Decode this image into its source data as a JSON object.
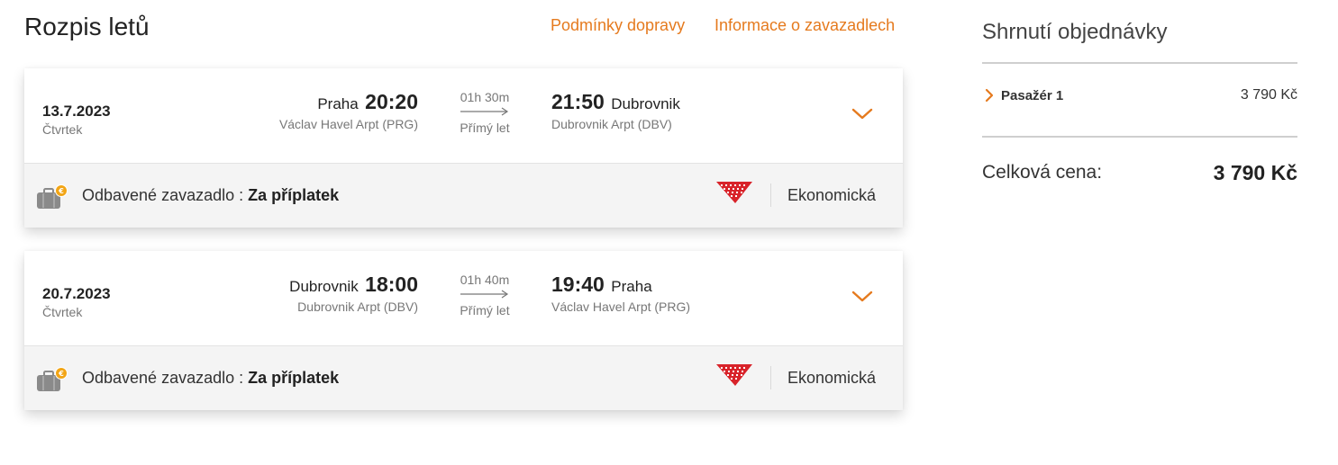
{
  "header": {
    "title": "Rozpis letů",
    "conditions_link": "Podmínky dopravy",
    "baggage_link": "Informace o zavazadlech"
  },
  "flights": [
    {
      "date": "13.7.2023",
      "weekday": "Čtvrtek",
      "departure": {
        "city": "Praha",
        "time": "20:20",
        "airport": "Václav Havel Arpt (PRG)"
      },
      "duration": "01h 30m",
      "stops": "Přímý let",
      "arrival": {
        "city": "Dubrovnik",
        "time": "21:50",
        "airport": "Dubrovnik Arpt (DBV)"
      },
      "baggage_label": "Odbavené zavazadlo :",
      "baggage_value": "Za příplatek",
      "cabin": "Ekonomická"
    },
    {
      "date": "20.7.2023",
      "weekday": "Čtvrtek",
      "departure": {
        "city": "Dubrovnik",
        "time": "18:00",
        "airport": "Dubrovnik Arpt (DBV)"
      },
      "duration": "01h 40m",
      "stops": "Přímý let",
      "arrival": {
        "city": "Praha",
        "time": "19:40",
        "airport": "Václav Havel Arpt (PRG)"
      },
      "baggage_label": "Odbavené zavazadlo :",
      "baggage_value": "Za příplatek",
      "cabin": "Ekonomická"
    }
  ],
  "summary": {
    "title": "Shrnutí objednávky",
    "passenger_label": "Pasažér 1",
    "passenger_price": "3 790 Kč",
    "total_label": "Celková cena:",
    "total_price": "3 790 Kč"
  },
  "colors": {
    "accent": "#e57a1e",
    "airline_red": "#d8232a",
    "card_footer_bg": "#f4f4f4"
  },
  "icons": {
    "expand": "chevron-down-icon",
    "baggage": "suitcase-euro-icon",
    "airline": "airline-logo-icon",
    "passenger_toggle": "chevron-right-icon"
  }
}
